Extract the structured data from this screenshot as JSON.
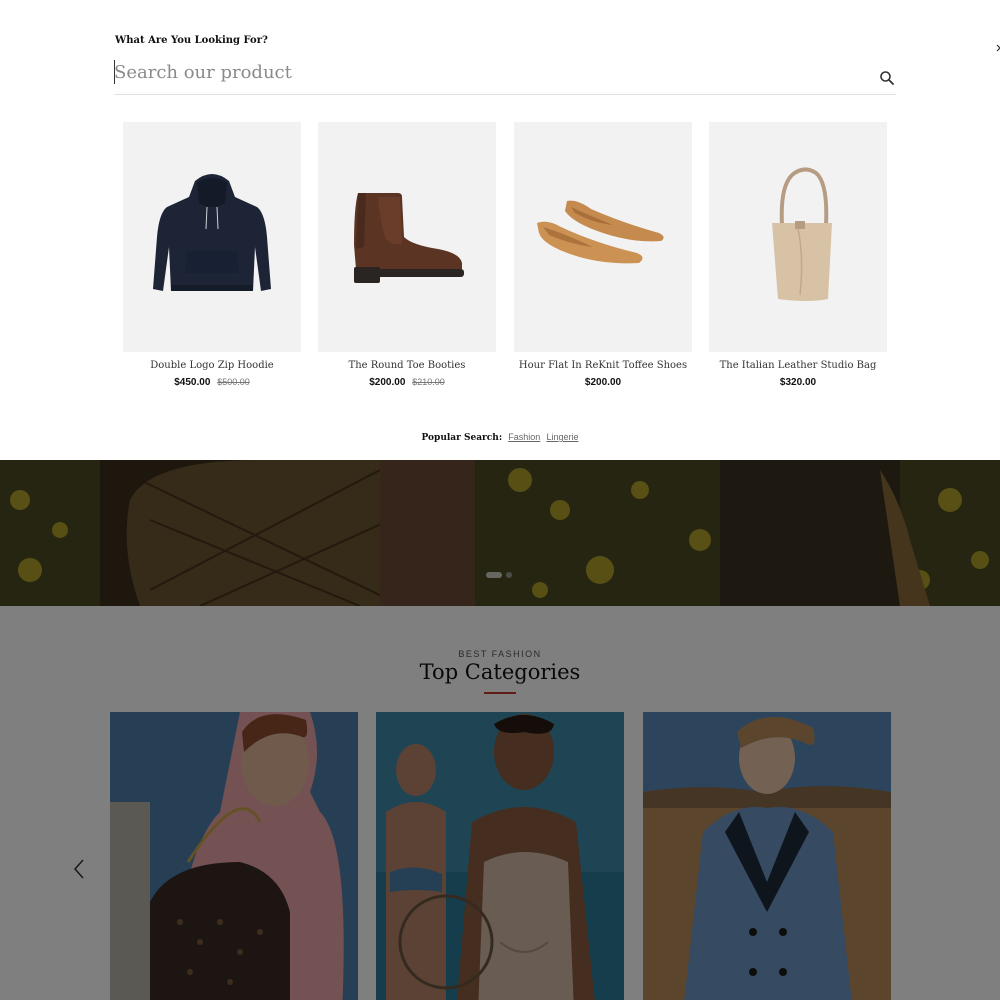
{
  "search": {
    "heading": "What Are You Looking For?",
    "placeholder": "Search our product",
    "value": ""
  },
  "products": [
    {
      "name": "Double Logo Zip Hoodie",
      "price": "$450.00",
      "old_price": "$500.00"
    },
    {
      "name": "The Round Toe Booties",
      "price": "$200.00",
      "old_price": "$210.00"
    },
    {
      "name": "Hour Flat In ReKnit Toffee Shoes",
      "price": "$200.00",
      "old_price": ""
    },
    {
      "name": "The Italian Leather Studio Bag",
      "price": "$320.00",
      "old_price": ""
    }
  ],
  "popular_search": {
    "label": "Popular Search:",
    "links": [
      "Fashion",
      "Lingerie"
    ]
  },
  "hero": {
    "slide_count": 2,
    "active_slide": 1
  },
  "categories": {
    "eyebrow": "BEST FASHION",
    "title": "Top Categories"
  },
  "colors": {
    "accent": "#c0392b",
    "thumb_bg": "#f2f2f2",
    "overlay": "rgba(0,0,0,0.5)"
  }
}
